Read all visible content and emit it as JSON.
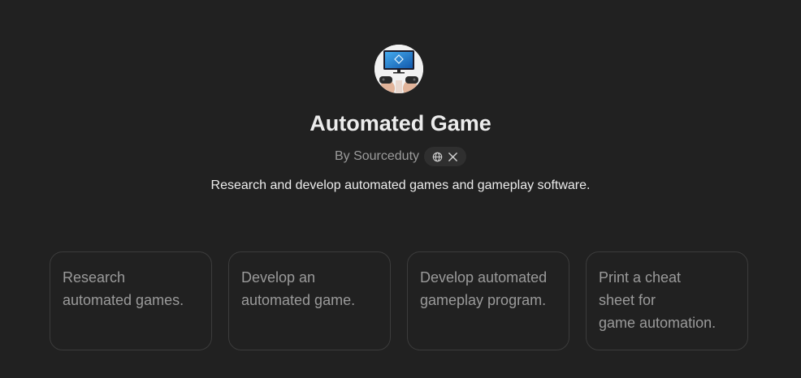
{
  "gpt": {
    "title": "Automated Game",
    "byline": "By Sourceduty",
    "description": "Research and develop automated games and gameplay software.",
    "avatar_icon": "computer-monitor-game-controllers",
    "social_links": [
      {
        "icon": "globe-icon"
      },
      {
        "icon": "x-logo-icon"
      }
    ]
  },
  "conversation_starters": [
    "Research\nautomated games.",
    "Develop an\nautomated game.",
    "Develop automated\ngameplay program.",
    "Print a cheat\nsheet for\ngame automation."
  ],
  "colors": {
    "background": "#212121",
    "title": "#ececec",
    "muted": "#9b9b9b",
    "card_border": "#3c3c3c",
    "pill_bg": "#2f2f2f"
  }
}
